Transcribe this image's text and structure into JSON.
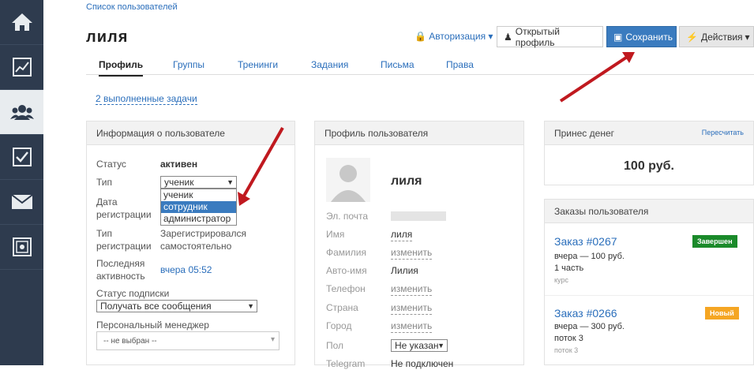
{
  "sidebar": {
    "items": [
      {
        "icon": "home-icon"
      },
      {
        "icon": "chart-icon"
      },
      {
        "icon": "users-icon"
      },
      {
        "icon": "checkbox-icon"
      },
      {
        "icon": "mail-icon"
      },
      {
        "icon": "safe-icon"
      }
    ],
    "colors": {
      "bg": "#2e3b4e",
      "active": "#e8ecef"
    }
  },
  "header": {
    "breadcrumb": "Список пользователей",
    "title": "лиля",
    "auth_label": "Авторизация",
    "profile_button": "Открытый профиль",
    "save_button": "Сохранить",
    "actions_button": "Действия"
  },
  "tabs": [
    "Профиль",
    "Группы",
    "Тренинги",
    "Задания",
    "Письма",
    "Права"
  ],
  "tasks_link": "2 выполненные задачи",
  "user_info": {
    "title": "Информация о пользователе",
    "status_label": "Статус",
    "status_value": "активен",
    "type_label": "Тип",
    "type_value": "ученик",
    "type_options": [
      "ученик",
      "сотрудник",
      "администратор"
    ],
    "reg_date_label": "Дата регистрации",
    "reg_type_label": "Тип регистрации",
    "reg_type_value": "Зарегистрировался самостоятельно",
    "last_activity_label": "Последняя активность",
    "last_activity_value": "вчера 05:52",
    "subscription_label": "Статус подписки",
    "subscription_value": "Получать все сообщения",
    "manager_label": "Персональный менеджер",
    "manager_value": "-- не выбран --"
  },
  "profile": {
    "title": "Профиль пользователя",
    "name": "лиля",
    "fields": [
      {
        "label": "Эл. почта",
        "value": ""
      },
      {
        "label": "Имя",
        "value": "лиля"
      },
      {
        "label": "Фамилия",
        "value": "изменить"
      },
      {
        "label": "Авто-имя",
        "value": "Лилия"
      },
      {
        "label": "Телефон",
        "value": "изменить"
      },
      {
        "label": "Страна",
        "value": "изменить"
      },
      {
        "label": "Город",
        "value": "изменить"
      },
      {
        "label": "Пол",
        "value": "Не указан"
      },
      {
        "label": "Telegram",
        "value": "Не подключен"
      }
    ]
  },
  "money": {
    "title": "Принес денег",
    "recalc": "Пересчитать",
    "amount": "100 руб."
  },
  "orders": {
    "title": "Заказы пользователя",
    "items": [
      {
        "number": "Заказ #0267",
        "line1": "вчера — 100 руб.",
        "line2": "1 часть",
        "line3": "курс",
        "badge": "Завершен",
        "badge_color": "#1a8a2a"
      },
      {
        "number": "Заказ #0266",
        "line1": "вчера — 300 руб.",
        "line2": "поток 3",
        "line3": "поток 3",
        "badge": "Новый",
        "badge_color": "#f5a623"
      }
    ]
  }
}
